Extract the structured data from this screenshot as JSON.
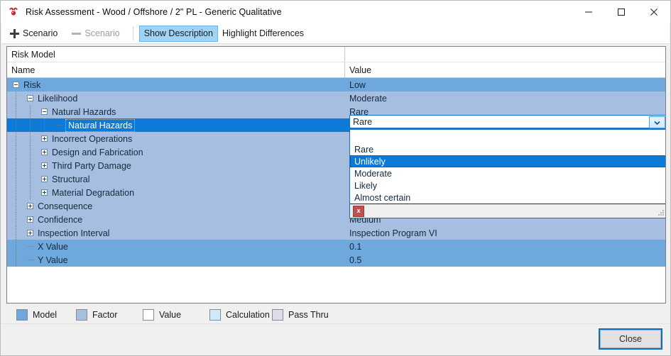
{
  "window": {
    "icon": "app-icon",
    "title": "Risk Assessment - Wood / Offshore / 2\" PL - Generic Qualitative",
    "controls": {
      "minimize": "minimize-icon",
      "maximize": "maximize-icon",
      "close": "close-icon"
    }
  },
  "toolbar": {
    "add_scenario": "Scenario",
    "remove_scenario": "Scenario",
    "show_description": "Show Description",
    "highlight_differences": "Highlight Differences"
  },
  "panel": {
    "model_band": "Risk Model",
    "columns": {
      "name": "Name",
      "value": "Value"
    }
  },
  "tree": {
    "rows": [
      {
        "label": "Risk",
        "value": "Low",
        "depth": 0,
        "expander": "minus",
        "style": "model"
      },
      {
        "label": "Likelihood",
        "value": "Moderate",
        "depth": 1,
        "expander": "minus",
        "style": "factor"
      },
      {
        "label": "Natural Hazards",
        "value": "Rare",
        "depth": 2,
        "expander": "minus",
        "style": "factor"
      },
      {
        "label": "Natural Hazards",
        "value": "Rare",
        "depth": 3,
        "expander": "stub",
        "style": "selected"
      },
      {
        "label": "Incorrect Operations",
        "value": "",
        "depth": 2,
        "expander": "plus",
        "style": "factor"
      },
      {
        "label": "Design and Fabrication",
        "value": "",
        "depth": 2,
        "expander": "plus",
        "style": "factor"
      },
      {
        "label": "Third Party Damage",
        "value": "",
        "depth": 2,
        "expander": "plus",
        "style": "factor"
      },
      {
        "label": "Structural",
        "value": "",
        "depth": 2,
        "expander": "plus",
        "style": "factor"
      },
      {
        "label": "Material Degradation",
        "value": "",
        "depth": 2,
        "expander": "plus",
        "style": "factor"
      },
      {
        "label": "Consequence",
        "value": "",
        "depth": 1,
        "expander": "plus",
        "style": "factor"
      },
      {
        "label": "Confidence",
        "value": "Medium",
        "depth": 1,
        "expander": "plus",
        "style": "factor"
      },
      {
        "label": "Inspection Interval",
        "value": "Inspection Program VI",
        "depth": 1,
        "expander": "plus",
        "style": "factor"
      },
      {
        "label": "X Value",
        "value": "0.1",
        "depth": 1,
        "expander": "none",
        "style": "model"
      },
      {
        "label": "Y Value",
        "value": "0.5",
        "depth": 1,
        "expander": "none",
        "style": "model"
      }
    ]
  },
  "combo": {
    "value": "Rare",
    "toggle_icon": "chevron-down-icon",
    "options": [
      "",
      "Rare",
      "Unlikely",
      "Moderate",
      "Likely",
      "Almost certain"
    ],
    "highlighted": "Unlikely",
    "clear_icon": "clear-x-icon",
    "clear_label": "x",
    "resize_grip": "resize-grip-icon"
  },
  "legend": {
    "items": [
      {
        "label": "Model",
        "color": "#6fa8dc"
      },
      {
        "label": "Factor",
        "color": "#a6bfe0"
      },
      {
        "label": "Value",
        "color": "#ffffff"
      },
      {
        "label": "Calculation",
        "color": "#cfeaf9"
      },
      {
        "label": "Pass Thru",
        "color": "#dcdcea"
      }
    ]
  },
  "footer": {
    "close_button": "Close"
  }
}
